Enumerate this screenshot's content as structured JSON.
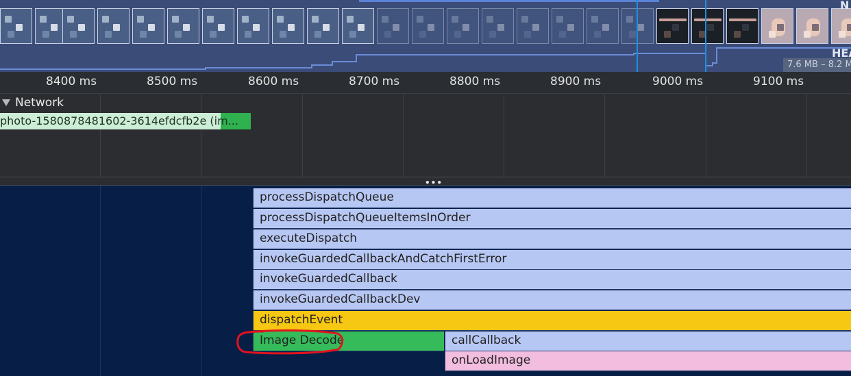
{
  "overview": {
    "heap_label": "HEA",
    "n_label": "N",
    "heap_range": "7.6 MB – 8.2 M"
  },
  "ruler": {
    "ticks": [
      "8400 ms",
      "8500 ms",
      "8600 ms",
      "8700 ms",
      "8800 ms",
      "8900 ms",
      "9000 ms",
      "9100 ms"
    ]
  },
  "network": {
    "header": "Network",
    "request_label": "photo-1580878481602-3614efdcfb2e (im..."
  },
  "flame": {
    "entries": [
      "processDispatchQueue",
      "processDispatchQueueItemsInOrder",
      "executeDispatch",
      "invokeGuardedCallbackAndCatchFirstError",
      "invokeGuardedCallback",
      "invokeGuardedCallbackDev",
      "dispatchEvent",
      "Image Decode",
      "callCallback",
      "onLoadImage"
    ],
    "colors": {
      "js": "#b7c7f3",
      "event": "#f6c713",
      "decode": "#35bb5a",
      "load": "#f2bddf"
    }
  },
  "divider": {
    "dots": "•••"
  }
}
